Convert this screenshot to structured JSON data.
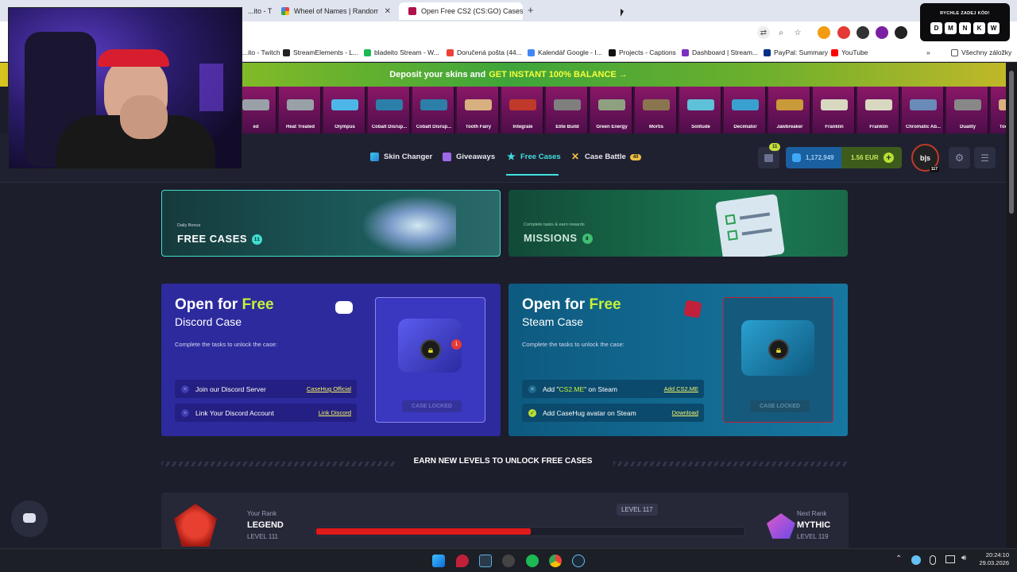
{
  "browser": {
    "tabs": [
      {
        "label": "...ito - Twitch",
        "color": "#9146ff"
      },
      {
        "label": "Wheel of Names | Random name",
        "color": "#4caf50"
      },
      {
        "label": "Open Free CS2 (CS:GO) Cases",
        "color": "#b0124b"
      }
    ],
    "bookmarks": [
      {
        "label": "...ito - Twitch",
        "color": "#9146ff"
      },
      {
        "label": "StreamElements - L...",
        "color": "#222"
      },
      {
        "label": "bladeito Stream - W...",
        "color": "#1db954"
      },
      {
        "label": "Doručená pošta (44...",
        "color": "#ea4335"
      },
      {
        "label": "Kalendář Google - I...",
        "color": "#4285f4"
      },
      {
        "label": "Projects - Captions",
        "color": "#111"
      },
      {
        "label": "Dashboard | Stream...",
        "color": "#7b2fbf"
      },
      {
        "label": "PayPal: Summary",
        "color": "#003087"
      },
      {
        "label": "YouTube",
        "color": "#ff0000"
      },
      {
        "label": "Všechny záložky",
        "color": "#555"
      }
    ]
  },
  "code_box": {
    "title": "RYCHLE ZADEJ KÓD!",
    "keys": [
      "D",
      "M",
      "N",
      "K",
      "W"
    ]
  },
  "promo": {
    "text": "Deposit your skins and",
    "highlight": "GET INSTANT 100% BALANCE →"
  },
  "ticker": [
    {
      "name": "ed",
      "color": "#9aa0a8"
    },
    {
      "name": "Heat Treated",
      "color": "#9aa0a8"
    },
    {
      "name": "Olympus",
      "color": "#4db6e8"
    },
    {
      "name": "Cobalt Disrup...",
      "color": "#2c7fa8"
    },
    {
      "name": "Cobalt Disrup...",
      "color": "#2c7fa8"
    },
    {
      "name": "Tooth Fairy",
      "color": "#d8b080"
    },
    {
      "name": "Integrale",
      "color": "#c0392b"
    },
    {
      "name": "Elite Build",
      "color": "#7f7f7f"
    },
    {
      "name": "Green Energy",
      "color": "#8fa080"
    },
    {
      "name": "Mortis",
      "color": "#8a7550"
    },
    {
      "name": "Solitude",
      "color": "#5fc1d8"
    },
    {
      "name": "Decimator",
      "color": "#3aa0d0"
    },
    {
      "name": "Jawbreaker",
      "color": "#c89a3a"
    },
    {
      "name": "Franklin",
      "color": "#d8d8c0"
    },
    {
      "name": "Franklin",
      "color": "#d8d8c0"
    },
    {
      "name": "Chromatic Ab...",
      "color": "#6a8ab8"
    },
    {
      "name": "Duality",
      "color": "#888"
    },
    {
      "name": "Tooth Fairy",
      "color": "#d8b080"
    }
  ],
  "nav": {
    "skin_changer": "Skin Changer",
    "giveaways": "Giveaways",
    "free_cases": "Free Cases",
    "case_battle": "Case Battle",
    "case_battle_count": "40",
    "gift_count": "11",
    "coins": "1,172,949",
    "balance": "1.56 EUR",
    "avatar_level": "117",
    "avatar_text": "b|s"
  },
  "banners": {
    "daily": {
      "small": "Daily Bonus",
      "title": "FREE CASES",
      "count": "11"
    },
    "missions": {
      "small": "Complete tasks & earn rewards",
      "title": "MISSIONS",
      "count": "8"
    }
  },
  "discord_card": {
    "open_for": "Open for",
    "free": "Free",
    "subtitle": "Discord Case",
    "sub": "Complete the tasks to unlock the case:",
    "tasks": [
      {
        "label": "Join our Discord Server",
        "link": "CaseHug Official",
        "done": false
      },
      {
        "label": "Link Your Discord Account",
        "link": "Link Discord",
        "done": false
      }
    ],
    "locked": "CASE LOCKED",
    "notif": "1"
  },
  "steam_card": {
    "open_for": "Open for",
    "free": "Free",
    "subtitle": "Steam Case",
    "sub": "Complete the tasks to unlock the case:",
    "tasks": [
      {
        "label_pre": "Add \"",
        "highlight": "CS2.ME",
        "label_post": "\" on Steam",
        "link": "Add CS2.ME",
        "done": false
      },
      {
        "label": "Add CaseHug avatar on Steam",
        "link": "Download",
        "done": true
      }
    ],
    "locked": "CASE LOCKED"
  },
  "earn": "EARN NEW LEVELS TO UNLOCK FREE CASES",
  "rank": {
    "your_rank_label": "Your Rank",
    "your_rank": "LEGEND",
    "your_level": "LEVEL 111",
    "current_level": "LEVEL 117",
    "progress": 0.5,
    "next_rank_label": "Next Rank",
    "next_rank": "MYTHIC",
    "next_level": "LEVEL 119"
  },
  "taskbar": {
    "time": "20:24:10",
    "date": "29.03.2026"
  }
}
